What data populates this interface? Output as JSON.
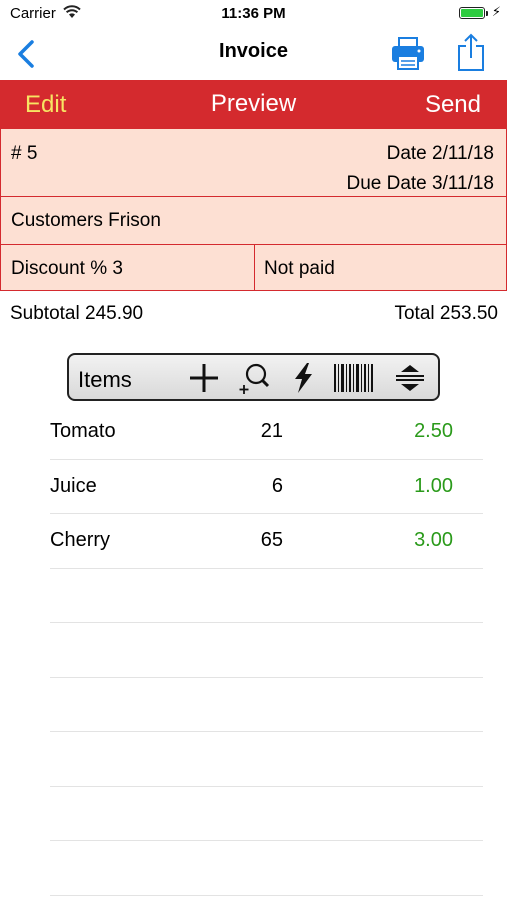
{
  "status_bar": {
    "carrier": "Carrier",
    "time": "11:36 PM",
    "battery_level": 1.0,
    "icons": [
      "wifi-icon",
      "battery-icon",
      "charging-icon"
    ]
  },
  "nav": {
    "title": "Invoice",
    "icons": [
      "back-chevron-icon",
      "print-icon",
      "share-icon"
    ],
    "accent_color": "#1a7ee0"
  },
  "toolbar": {
    "edit_label": "Edit",
    "preview_label": "Preview",
    "send_label": "Send",
    "background_color": "#d42a2e",
    "edit_color": "#f7e463"
  },
  "invoice": {
    "number": "# 5",
    "date": "Date 2/11/18",
    "due_date": "Due Date 3/11/18",
    "customer": "Customers Frison",
    "discount": "Discount % 3",
    "payment_status": "Not paid",
    "subtotal": "Subtotal 245.90",
    "total": "Total 253.50",
    "cell_background": "#fde0d3"
  },
  "items_bar": {
    "label": "Items",
    "icons": [
      "add-icon",
      "search-add-icon",
      "lightning-icon",
      "barcode-icon",
      "sort-icon"
    ]
  },
  "items": [
    {
      "name": "Tomato",
      "qty": "21",
      "price": "2.50"
    },
    {
      "name": "Juice",
      "qty": "6",
      "price": "1.00"
    },
    {
      "name": "Cherry",
      "qty": "65",
      "price": "3.00"
    }
  ],
  "price_color": "#2a9a1a"
}
